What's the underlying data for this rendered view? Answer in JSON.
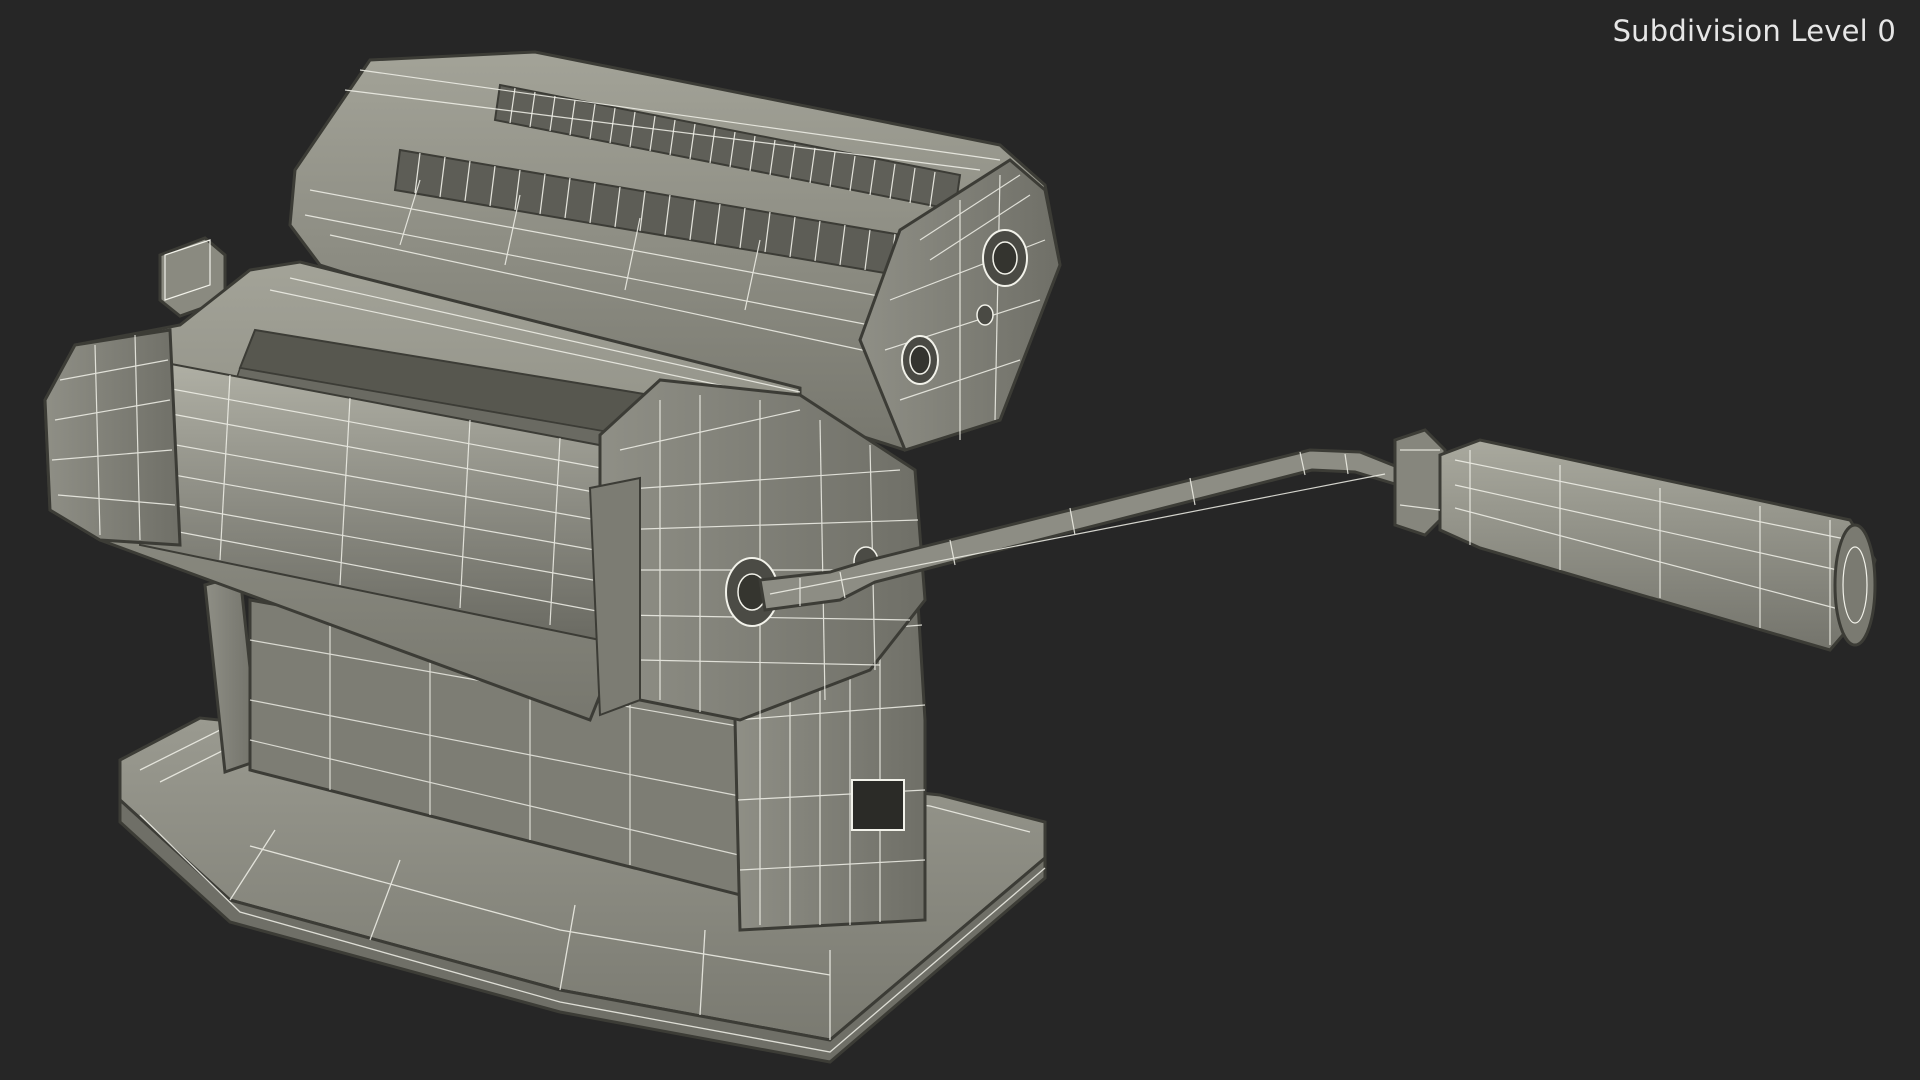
{
  "viewport": {
    "subdivision_label": "Subdivision Level 0",
    "background_color": "#262626",
    "mesh_fill": "#8e8e84",
    "mesh_dark": "#6c6c63",
    "mesh_light": "#a7a79c",
    "wire_color": "#f2f2ea",
    "edge_color": "#3c3c36",
    "subject_icon": "pasta-machine-wireframe"
  }
}
